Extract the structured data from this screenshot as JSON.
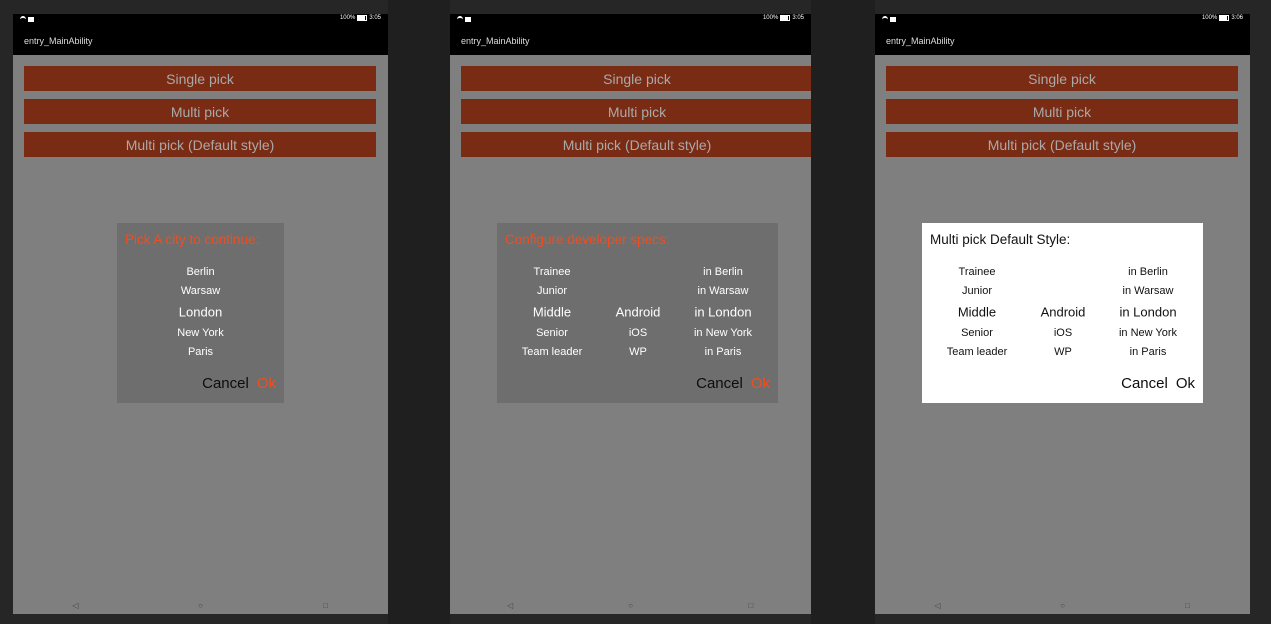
{
  "colors": {
    "accent": "#ee4f1f",
    "button_bg": "#7a2b14",
    "button_text": "#a9a9a9",
    "scrim": "#7f7f7f"
  },
  "icons": {
    "wifi": "wifi-icon",
    "sim": "sim-icon",
    "battery": "battery-icon",
    "back": "back-icon",
    "home": "home-icon",
    "recents": "recents-icon"
  },
  "screens": [
    {
      "status": {
        "battery": "100%",
        "time": "3:05"
      },
      "app_title": "entry_MainAbility",
      "buttons": [
        "Single pick",
        "Multi pick",
        "Multi pick (Default style)"
      ],
      "nav": {
        "back": "◁",
        "home": "○",
        "recents": "□"
      },
      "dialog": {
        "title": "Pick A city to continue:",
        "columns": [
          [
            "Berlin",
            "Warsaw",
            "London",
            "New York",
            "Paris"
          ]
        ],
        "cancel": "Cancel",
        "ok": "Ok"
      }
    },
    {
      "status": {
        "battery": "100%",
        "time": "3:05"
      },
      "app_title": "entry_MainAbility",
      "buttons": [
        "Single pick",
        "Multi pick",
        "Multi pick (Default style)"
      ],
      "nav": {
        "back": "◁",
        "home": "○",
        "recents": "□"
      },
      "dialog": {
        "title": "Configure developer specs:",
        "columns": [
          [
            "Trainee",
            "Junior",
            "Middle",
            "Senior",
            "Team leader"
          ],
          [
            "",
            "",
            "Android",
            "iOS",
            "WP"
          ],
          [
            "in Berlin",
            "in Warsaw",
            "in London",
            "in New York",
            "in Paris"
          ]
        ],
        "cancel": "Cancel",
        "ok": "Ok"
      }
    },
    {
      "status": {
        "battery": "100%",
        "time": "3:06"
      },
      "app_title": "entry_MainAbility",
      "buttons": [
        "Single pick",
        "Multi pick",
        "Multi pick (Default style)"
      ],
      "nav": {
        "back": "◁",
        "home": "○",
        "recents": "□"
      },
      "dialog": {
        "title": "Multi pick Default Style:",
        "columns": [
          [
            "Trainee",
            "Junior",
            "Middle",
            "Senior",
            "Team leader"
          ],
          [
            "",
            "",
            "Android",
            "iOS",
            "WP"
          ],
          [
            "in Berlin",
            "in Warsaw",
            "in London",
            "in New York",
            "in Paris"
          ]
        ],
        "cancel": "Cancel",
        "ok": "Ok"
      }
    }
  ]
}
